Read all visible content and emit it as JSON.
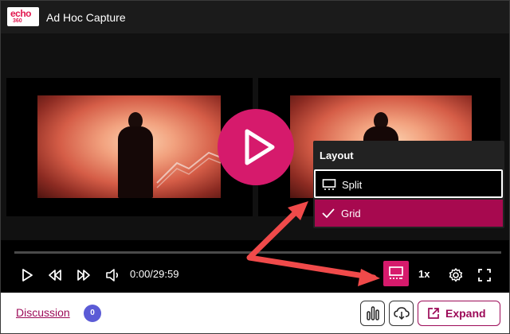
{
  "header": {
    "logo_top": "echo",
    "logo_bottom": "360",
    "title": "Ad Hoc Capture"
  },
  "player": {
    "play_icon": "play-icon",
    "layout_menu": {
      "heading": "Layout",
      "options": [
        {
          "label": "Split",
          "icon": "monitor-icon",
          "state": "focused"
        },
        {
          "label": "Grid",
          "icon": "check-icon",
          "state": "selected"
        }
      ]
    },
    "controls": {
      "time": "0:00/29:59",
      "speed": "1x",
      "icons": [
        "play-icon",
        "rewind-icon",
        "fast-forward-icon",
        "volume-icon",
        "layout-icon",
        "gear-icon",
        "fullscreen-icon"
      ]
    }
  },
  "footer": {
    "discussion_label": "Discussion",
    "discussion_count": "0",
    "expand_label": "Expand",
    "icons": [
      "bar-chart-icon",
      "cloud-download-icon",
      "external-link-icon"
    ]
  },
  "colors": {
    "accent": "#d61a6c",
    "menu_selected": "#a7094f",
    "link": "#9c0a58",
    "badge": "#5b5bd6",
    "annotation_arrow": "#f04a4a"
  }
}
